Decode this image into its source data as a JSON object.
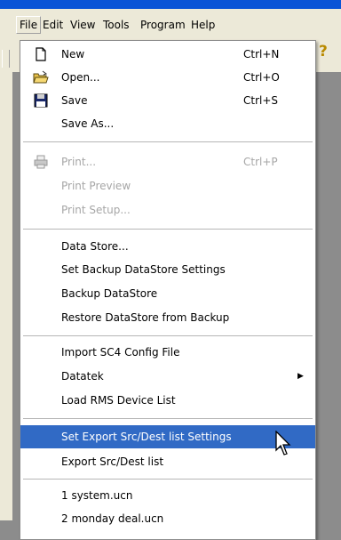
{
  "menubar": {
    "items": [
      "File",
      "Edit",
      "View",
      "Tools",
      "Program",
      "Help"
    ]
  },
  "file_menu": {
    "items": [
      {
        "label": "New",
        "shortcut": "Ctrl+N",
        "icon": "new-document-icon"
      },
      {
        "label": "Open...",
        "shortcut": "Ctrl+O",
        "icon": "open-folder-icon"
      },
      {
        "label": "Save",
        "shortcut": "Ctrl+S",
        "icon": "floppy-disk-icon"
      },
      {
        "label": "Save As..."
      },
      {
        "label": "Print...",
        "shortcut": "Ctrl+P",
        "icon": "printer-icon",
        "disabled": true
      },
      {
        "label": "Print Preview",
        "disabled": true
      },
      {
        "label": "Print Setup...",
        "disabled": true
      },
      {
        "label": "Data Store..."
      },
      {
        "label": "Set Backup DataStore Settings"
      },
      {
        "label": "Backup DataStore"
      },
      {
        "label": "Restore DataStore from Backup"
      },
      {
        "label": "Import SC4 Config File"
      },
      {
        "label": "Datatek",
        "submenu": true
      },
      {
        "label": "Load RMS Device List"
      },
      {
        "label": "Set Export Src/Dest list Settings",
        "highlighted": true
      },
      {
        "label": "Export Src/Dest list"
      },
      {
        "label": "1 system.ucn"
      },
      {
        "label": "2 monday deal.ucn"
      }
    ]
  },
  "colors": {
    "menu_background": "#ffffff",
    "highlight": "#316ac5",
    "disabled_text": "#a6a6a6",
    "menubar_background": "#ece9d8",
    "titlebar": "#0a54d6"
  }
}
